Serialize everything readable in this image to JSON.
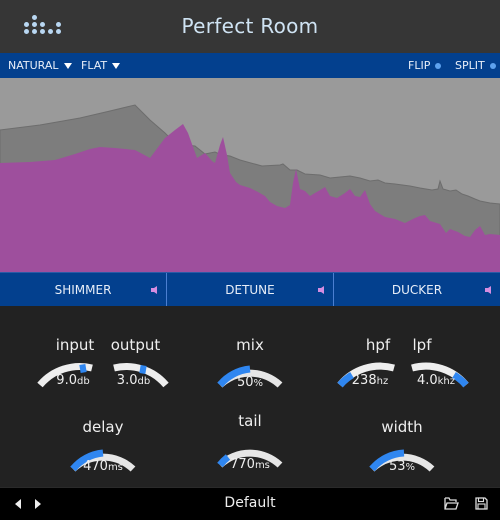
{
  "app": {
    "title": "Perfect Room"
  },
  "topbar": {
    "left": [
      {
        "label": "NATURAL",
        "icon": "dropdown-triangle"
      },
      {
        "label": "FLAT",
        "icon": "dropdown-triangle"
      }
    ],
    "right": [
      {
        "label": "FLIP",
        "icon": "toggle-dot"
      },
      {
        "label": "SPLIT",
        "icon": "toggle-dot"
      }
    ]
  },
  "effects_tabs": [
    {
      "label": "SHIMMER",
      "icon": "speaker-icon"
    },
    {
      "label": "DETUNE",
      "icon": "speaker-icon"
    },
    {
      "label": "DUCKER",
      "icon": "speaker-icon"
    }
  ],
  "knobs": {
    "input": {
      "label": "input",
      "value": "9.0",
      "unit": "db",
      "position": 0.85
    },
    "output": {
      "label": "output",
      "value": "3.0",
      "unit": "db",
      "position": 0.62
    },
    "mix": {
      "label": "mix",
      "value": "50",
      "unit": "%",
      "position": 0.5
    },
    "hpf": {
      "label": "hpf",
      "value": "238",
      "unit": "hz",
      "position": 0.2
    },
    "lpf": {
      "label": "lpf",
      "value": "4.0",
      "unit": "khz",
      "position": 0.8
    },
    "delay": {
      "label": "delay",
      "value": "470",
      "unit": "ms",
      "position": 0.5
    },
    "tail": {
      "label": "tail",
      "value": "770",
      "unit": "ms",
      "position": 0.12
    },
    "width": {
      "label": "width",
      "value": "53",
      "unit": "%",
      "position": 0.53
    }
  },
  "footer": {
    "preset": "Default",
    "prev_icon": "prev-arrow",
    "next_icon": "next-arrow",
    "open_icon": "folder-open-icon",
    "save_icon": "save-icon"
  },
  "colors": {
    "accent": "#2f86f0",
    "bar_blue": "#03408e",
    "spectrum_purple": "#9e4f9d",
    "spectrum_dark": "#7d7d7d",
    "spectrum_bg": "#9a9a9a"
  }
}
